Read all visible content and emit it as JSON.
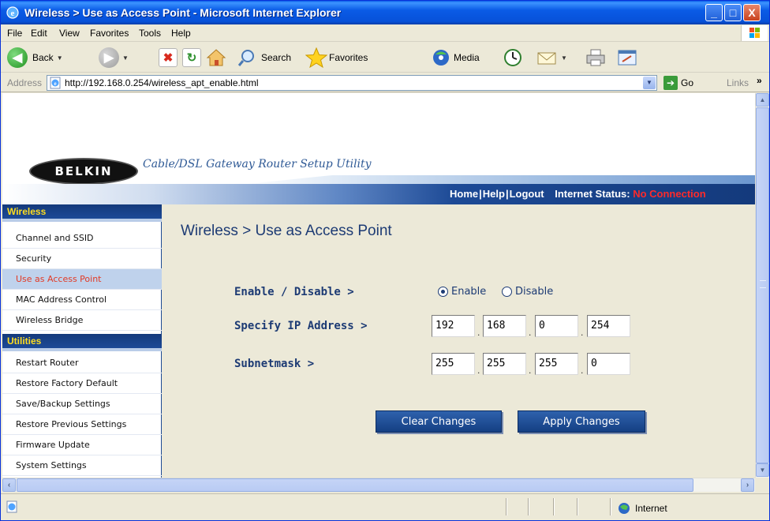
{
  "window": {
    "title": "Wireless > Use as Access Point - Microsoft Internet Explorer",
    "minimize": "_",
    "maximize": "□",
    "close": "X"
  },
  "menu": [
    "File",
    "Edit",
    "View",
    "Favorites",
    "Tools",
    "Help"
  ],
  "toolbar": {
    "back_label": "Back",
    "search_label": "Search",
    "favorites_label": "Favorites",
    "media_label": "Media"
  },
  "address": {
    "label": "Address",
    "url": "http://192.168.0.254/wireless_apt_enable.html",
    "go_label": "Go",
    "links_label": "Links"
  },
  "header": {
    "logo": "BELKIN",
    "tagline": "Cable/DSL Gateway Router Setup Utility",
    "home": "Home",
    "help": "Help",
    "logout": "Logout",
    "separator": "|",
    "internet_status_label": "Internet Status:",
    "internet_status_value": "No Connection"
  },
  "sidebar": {
    "wireless_heading": "Wireless",
    "wireless_items": [
      "Channel and SSID",
      "Security",
      "Use as Access Point",
      "MAC Address Control",
      "Wireless Bridge"
    ],
    "utilities_heading": "Utilities",
    "utilities_items": [
      "Restart Router",
      "Restore Factory Default",
      "Save/Backup Settings",
      "Restore Previous Settings",
      "Firmware Update",
      "System Settings"
    ],
    "active_item": "Use as Access Point"
  },
  "content": {
    "title": "Wireless > Use as Access Point",
    "enable_disable_label": "Enable / Disable >",
    "enable_option": "Enable",
    "disable_option": "Disable",
    "selected_option": "Enable",
    "ip_label": "Specify IP Address >",
    "ip_octets": [
      "192",
      "168",
      "0",
      "254"
    ],
    "subnet_label": "Subnetmask >",
    "subnet_octets": [
      "255",
      "255",
      "255",
      "0"
    ],
    "octet_separator": ".",
    "clear_button": "Clear Changes",
    "apply_button": "Apply Changes"
  },
  "status": {
    "zone": "Internet"
  },
  "colors": {
    "title_bar": "#0a5be6",
    "belkin_blue": "#1d4a96",
    "sidebar_heading_text": "#ffde20",
    "active_item_text": "#e23a25",
    "no_connection": "#ff2a2a",
    "form_text": "#1d3b74"
  }
}
